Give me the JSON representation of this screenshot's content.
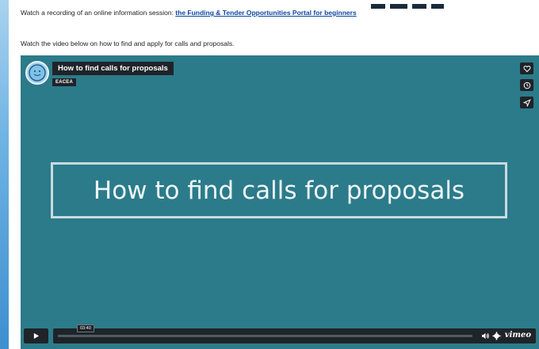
{
  "page": {
    "intro_prefix": "Watch a recording of an online information session: ",
    "intro_link": "the Funding & Tender Opportunities Portal for beginners",
    "subtitle": "Watch the video below on how to find and apply for calls and proposals."
  },
  "video": {
    "title": "How to find calls for proposals",
    "author": "EACEA",
    "slide_text": "How to find calls for proposals",
    "time_tooltip": "03:40",
    "progress": 0.0,
    "brand": "vimeo",
    "icons": {
      "like": "heart-icon",
      "watch_later": "clock-icon",
      "share": "send-icon",
      "play": "play-icon",
      "volume": "volume-icon",
      "settings": "gear-icon"
    }
  },
  "colors": {
    "link": "#0e47a1",
    "player_bg": "#2c7b8a",
    "control_bg": "#1f2429"
  }
}
